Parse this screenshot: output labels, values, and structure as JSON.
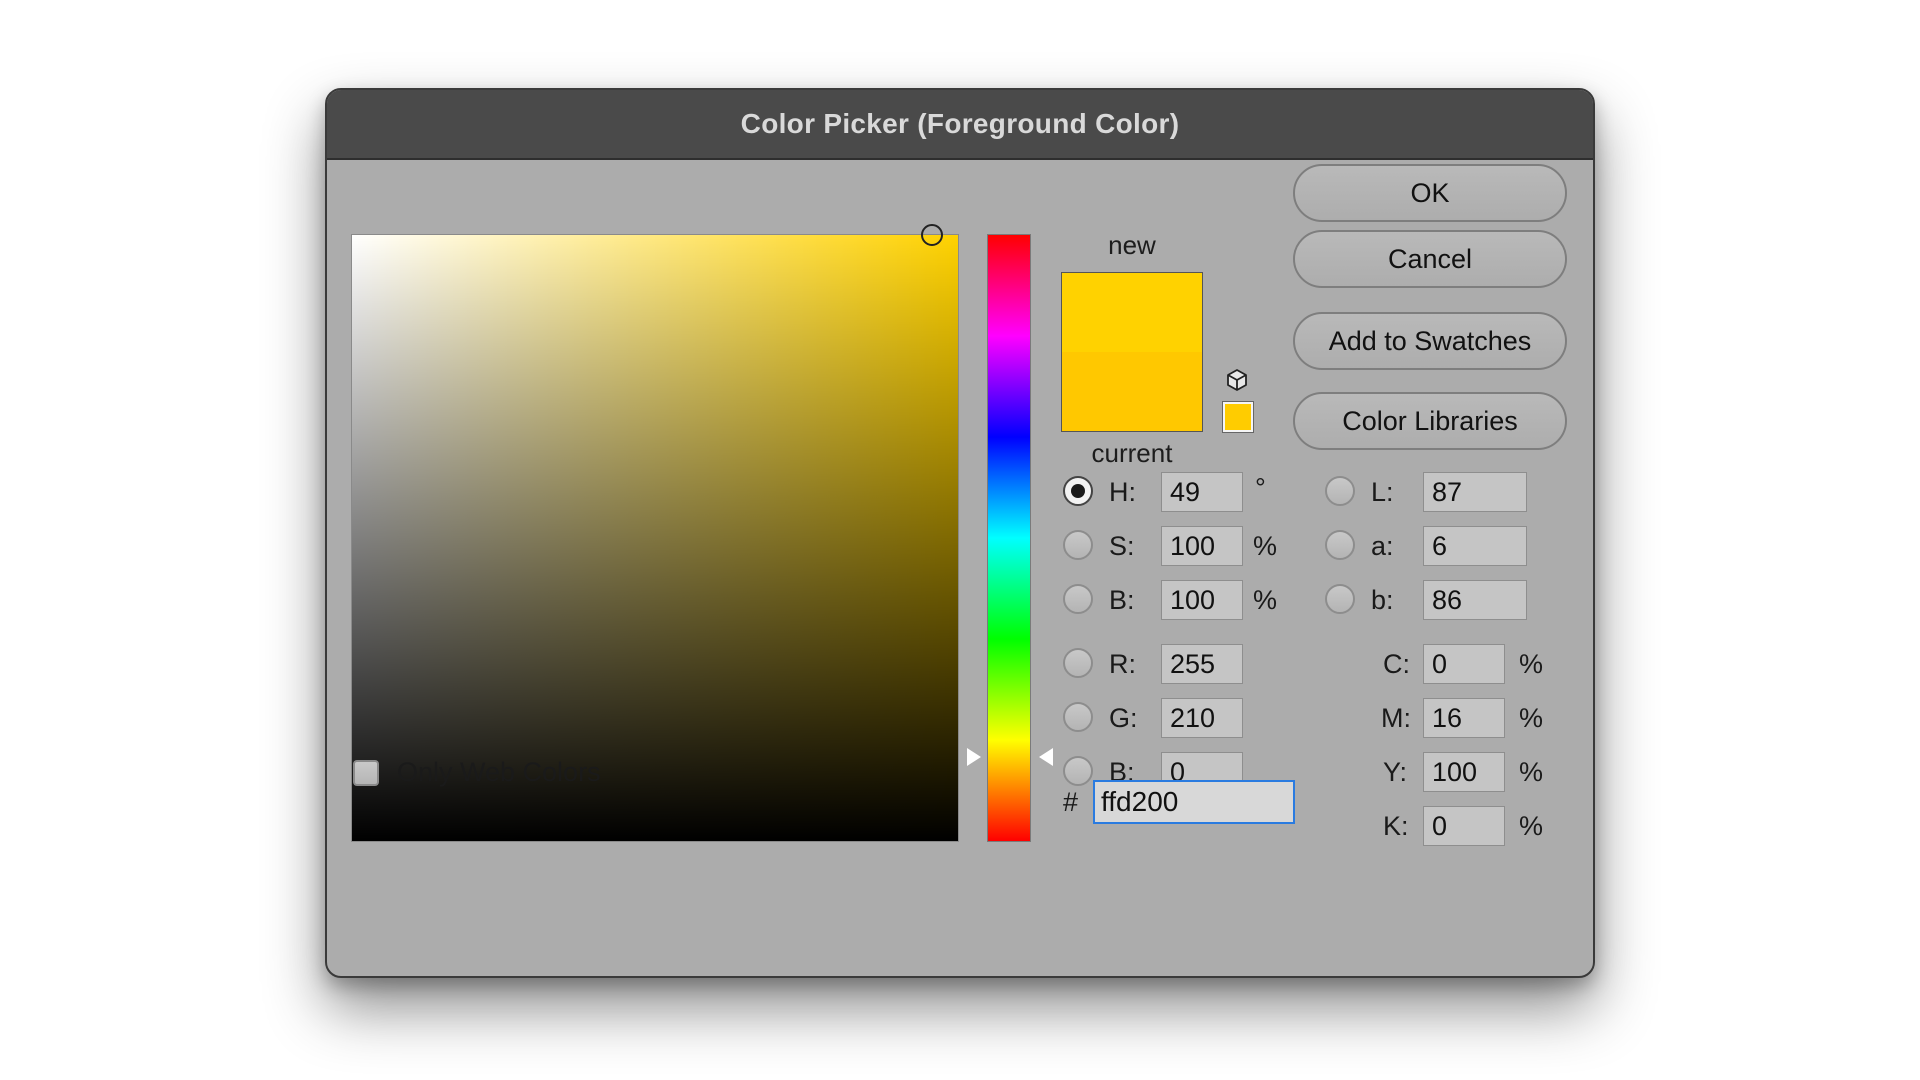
{
  "window": {
    "title": "Color Picker (Foreground Color)"
  },
  "swatch": {
    "new_label": "new",
    "current_label": "current",
    "new_color": "#ffd200",
    "current_color": "#ffc800",
    "web_safe_color": "#ffcc00"
  },
  "buttons": {
    "ok": "OK",
    "cancel": "Cancel",
    "add_to_swatches": "Add to Swatches",
    "color_libraries": "Color Libraries"
  },
  "hsb": {
    "h_label": "H:",
    "h_value": "49",
    "h_unit": "°",
    "s_label": "S:",
    "s_value": "100",
    "s_unit": "%",
    "b_label": "B:",
    "b_value": "100",
    "b_unit": "%"
  },
  "rgb": {
    "r_label": "R:",
    "r_value": "255",
    "g_label": "G:",
    "g_value": "210",
    "b_label": "B:",
    "b_value": "0"
  },
  "lab": {
    "l_label": "L:",
    "l_value": "87",
    "a_label": "a:",
    "a_value": "6",
    "b_label": "b:",
    "b_value": "86"
  },
  "cmyk": {
    "c_label": "C:",
    "c_value": "0",
    "c_unit": "%",
    "m_label": "M:",
    "m_value": "16",
    "m_unit": "%",
    "y_label": "Y:",
    "y_value": "100",
    "y_unit": "%",
    "k_label": "K:",
    "k_value": "0",
    "k_unit": "%"
  },
  "hex": {
    "prefix": "#",
    "value": "ffd200"
  },
  "options": {
    "only_web_colors_label": "Only Web Colors",
    "only_web_colors_checked": false,
    "selected_mode": "H"
  },
  "icons": {
    "gamut_warning": "cube-icon",
    "hue_marker": "triangle-arrow-icon"
  }
}
